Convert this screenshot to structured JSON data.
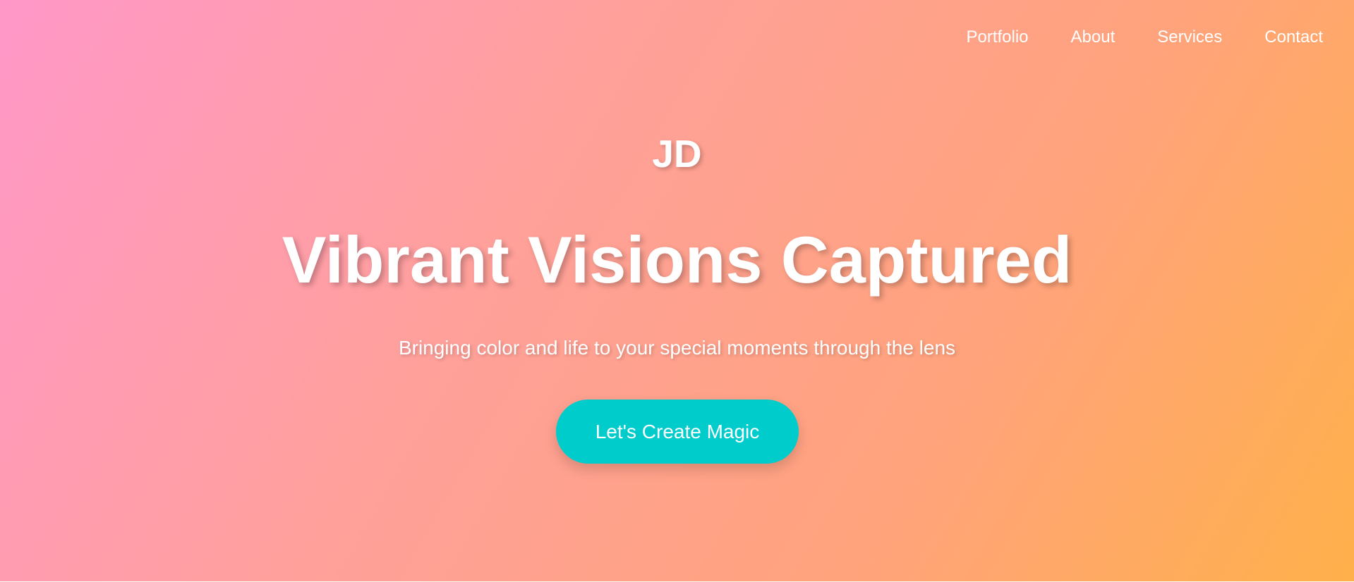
{
  "nav": {
    "items": [
      {
        "label": "Portfolio"
      },
      {
        "label": "About"
      },
      {
        "label": "Services"
      },
      {
        "label": "Contact"
      }
    ]
  },
  "hero": {
    "logo": "JD",
    "title": "Vibrant Visions Captured",
    "subtitle": "Bringing color and life to your special moments through the lens",
    "cta_label": "Let's Create Magic"
  },
  "colors": {
    "gradient_start": "#ff98c8",
    "gradient_middle": "#ffa09a",
    "gradient_end": "#ffb04a",
    "cta_background": "#00cccc",
    "text": "#ffffff"
  }
}
